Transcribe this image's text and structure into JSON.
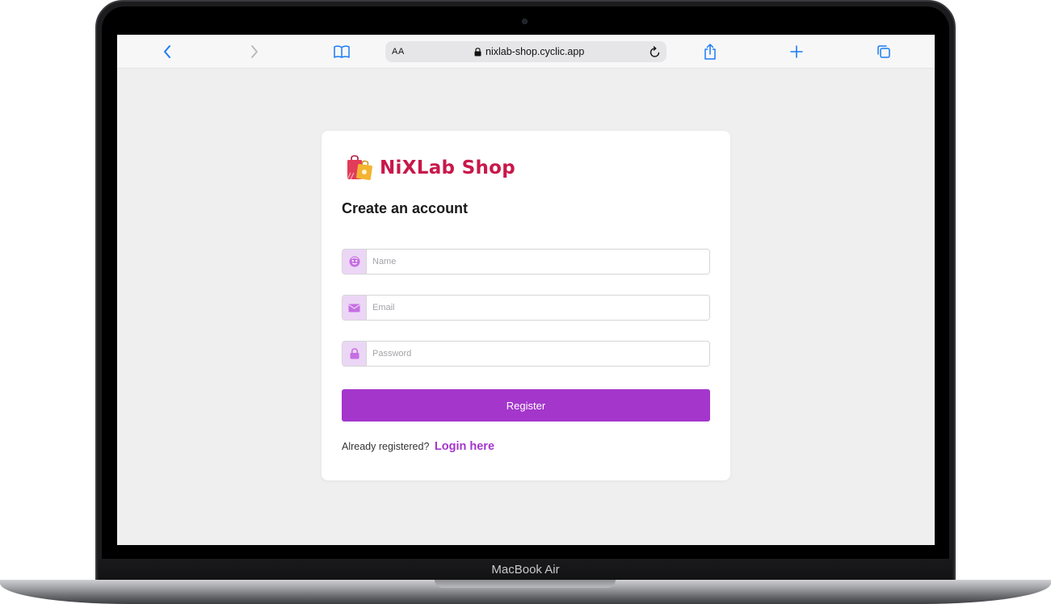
{
  "device": {
    "model_label": "MacBook Air"
  },
  "browser": {
    "reader_label": "AA",
    "url": "nixlab-shop.cyclic.app",
    "icons": [
      "chevron-left-icon",
      "chevron-right-icon",
      "book-icon",
      "lock-icon",
      "reload-icon",
      "share-icon",
      "plus-icon",
      "tabs-icon"
    ]
  },
  "page": {
    "brand_name": "NiXLab Shop",
    "heading": "Create an account",
    "fields": {
      "name_placeholder": "Name",
      "email_placeholder": "Email",
      "password_placeholder": "Password"
    },
    "register_label": "Register",
    "footer_text": "Already registered?",
    "login_link": "Login here"
  },
  "colors": {
    "accent": "#a436cc",
    "brand": "#c8184a",
    "icon_bg": "#ecd6f5",
    "browser_blue": "#1a7cf3",
    "page_bg": "#efefef"
  }
}
